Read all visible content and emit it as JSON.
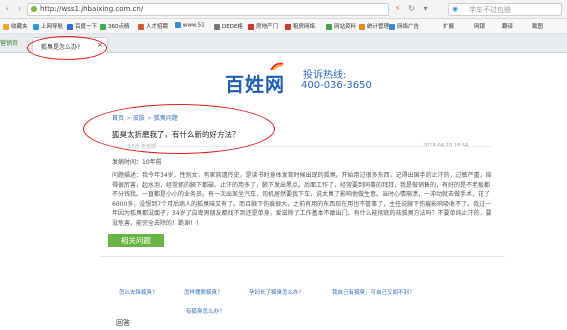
{
  "browser": {
    "url": "http://wss1.jhbaixing.com.cn/",
    "search_placeholder": "学车不过包赔"
  },
  "bookmarks": [
    {
      "label": "收藏夹",
      "color": "#f0a830"
    },
    {
      "label": "上网导航",
      "color": "#2d9bd6"
    },
    {
      "label": "百度一下",
      "color": "#2e6fd3"
    },
    {
      "label": "360点睛",
      "color": "#3fae49"
    },
    {
      "label": "人才招聘",
      "color": "#d65a2d"
    },
    {
      "label": "www.51",
      "color": "#3b8fd8"
    },
    {
      "label": "DEDE格",
      "color": "#777777"
    },
    {
      "label": "房地产门",
      "color": "#d0392b"
    },
    {
      "label": "租房网络",
      "color": "#d0392b"
    },
    {
      "label": "网站资料",
      "color": "#4aa14a"
    },
    {
      "label": "统计管理",
      "color": "#e48b1c"
    },
    {
      "label": "网络广告",
      "color": "#3a8ad6"
    }
  ],
  "bookmarks_right": [
    "扩展",
    "网银",
    "翻译",
    "截图"
  ],
  "tabs": {
    "pinned": "营销页",
    "active": "狐臭是怎么办?"
  },
  "header": {
    "logo_text": "百姓网",
    "hotline_label": "投诉热线:",
    "hotline_number": "400-036-3650"
  },
  "breadcrumb": {
    "home": "首页",
    "sep1": ">",
    "level1": "皮肤",
    "sep2": ">",
    "level2": "狐臭问题"
  },
  "question": {
    "title": "狐臭太折磨我了，有什么新的好方法？",
    "user": "14北 无日期",
    "date": "2018-04-10  18:54",
    "age_line": "发病时间：10年前",
    "description": "问题描述：我今年34岁，性别女，有家族遗传史，是读书时身体发育时候出现的狐臭。开始用过很多东西，记得出国手的止汗的，过敏严重，痒得很厉害，起水泡，经常抓的腋下都破。止汗的用多了，腋下发出黑点。后面工作了，经常要到同事的拜拜，我是做销售的，有好的是不老板都不分钱我。一直都是小小的业务员。有一次出差坐汽车，司机居然要我下车，说太臭了影响他做生意。当时心情崩溃，一冲动就去做手术，花了6000多，没想到7个月后病人的狐臭味又有了。而且腋下伤痕很大，之前有用的东西现在用也不管事了，主任说腋下伤痕影响吸收不了。我过一年因为狐臭都没面子，34岁了自卑男朋友都找不到还是单身，爱滋除了工作基本不敢出门。有什么能彻底的祛狐臭方法吗？不要单纯止汗的，要没危害，能完全去除的！跪谢！！"
  },
  "related": {
    "button": "相关问题",
    "links": [
      "怎么去除狐臭？",
      "怎样摆脱狐臭？",
      "孕妇长了狐臭怎么办？",
      "我自己有狐臭，可自己又闻不到？",
      "有狐臭怎么办？"
    ]
  },
  "answers_label": "回答"
}
